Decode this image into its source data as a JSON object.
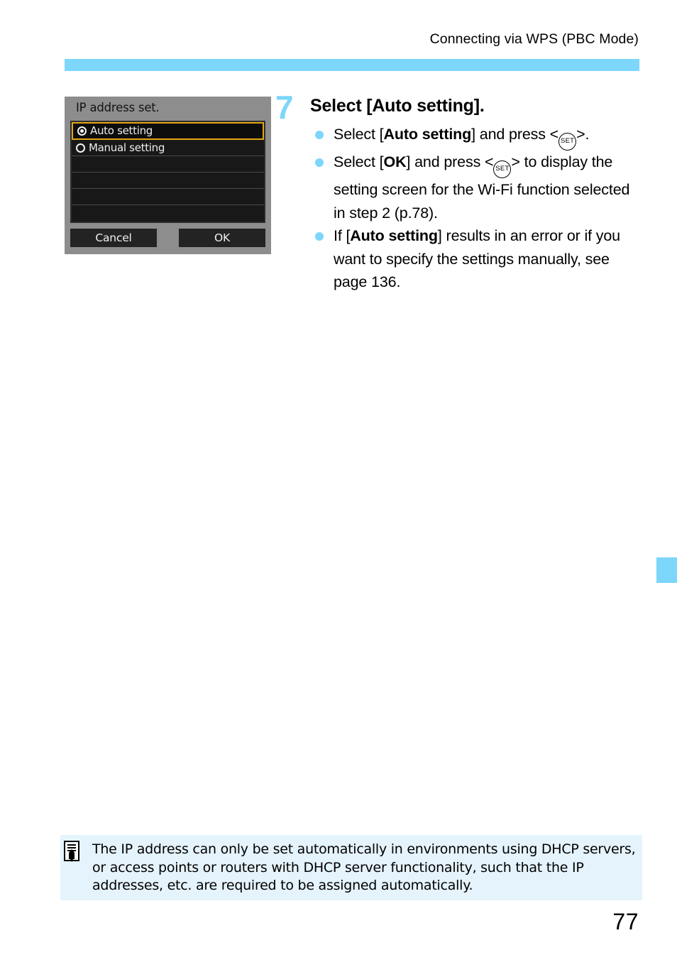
{
  "header": {
    "running_title": "Connecting via WPS (PBC Mode)",
    "rule_color": "#7dd6fb"
  },
  "edge_tab": {
    "name": "chapter-tab",
    "color": "#7dd6fb"
  },
  "figure": {
    "screen_title": "IP address set.",
    "rows": [
      {
        "label": "Auto setting",
        "radio": "selected",
        "highlighted": true
      },
      {
        "label": "Manual setting",
        "radio": "unselected",
        "highlighted": false
      },
      {
        "label": "",
        "radio": "none",
        "highlighted": false
      },
      {
        "label": "",
        "radio": "none",
        "highlighted": false
      },
      {
        "label": "",
        "radio": "none",
        "highlighted": false
      },
      {
        "label": "",
        "radio": "none",
        "highlighted": false
      }
    ],
    "cancel_label": "Cancel",
    "ok_label": "OK",
    "highlight_color": "#e2a615"
  },
  "step": {
    "number": "7",
    "heading": "Select [Auto setting].",
    "number_color": "#7dd6fb",
    "bullets": [
      {
        "parts": [
          {
            "t": "Select [",
            "style": "normal"
          },
          {
            "t": "Auto setting",
            "style": "bold"
          },
          {
            "t": "] and press <",
            "style": "normal"
          },
          {
            "t": "SET",
            "style": "icon"
          },
          {
            "t": ">.",
            "style": "normal"
          }
        ]
      },
      {
        "parts": [
          {
            "t": "Select [",
            "style": "normal"
          },
          {
            "t": "OK",
            "style": "bold"
          },
          {
            "t": "] and press <",
            "style": "normal"
          },
          {
            "t": "SET",
            "style": "icon"
          },
          {
            "t": "> to display the setting screen for the Wi-Fi function selected in step 2 (p.78).",
            "style": "normal"
          }
        ]
      },
      {
        "parts": [
          {
            "t": "If [",
            "style": "normal"
          },
          {
            "t": "Auto setting",
            "style": "bold"
          },
          {
            "t": "] results in an error or if you want to specify the settings manually, see page 136.",
            "style": "normal"
          }
        ]
      }
    ]
  },
  "note": {
    "icon": "note-pencil-icon",
    "text": "The IP address can only be set automatically in environments using DHCP servers, or access points or routers with DHCP server functionality, such that the IP addresses, etc. are required to be assigned automatically.",
    "background": "#e5f3fc"
  },
  "page_number": "77"
}
